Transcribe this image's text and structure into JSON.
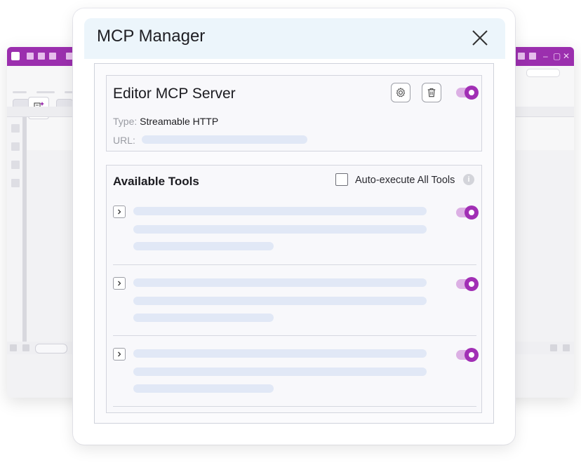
{
  "dialog": {
    "title": "MCP Manager",
    "close_icon": "close-icon"
  },
  "server": {
    "name": "Editor MCP Server",
    "type_label": "Type:",
    "type_value": "Streamable HTTP",
    "url_label": "URL:",
    "enabled": true,
    "settings_icon": "gear-icon",
    "delete_icon": "trash-icon"
  },
  "tools": {
    "title": "Available Tools",
    "auto_execute_label": "Auto-execute All Tools",
    "auto_execute_checked": false,
    "info_icon": "info-icon",
    "items": [
      {
        "enabled": true,
        "expand_icon": "chevron-right-icon"
      },
      {
        "enabled": true,
        "expand_icon": "chevron-right-icon"
      },
      {
        "enabled": true,
        "expand_icon": "chevron-right-icon"
      }
    ]
  },
  "colors": {
    "accent": "#a12fb5",
    "accent_light": "#dcb0e4",
    "titlebar": "#9b2fae",
    "header_bg": "#ecf5fb",
    "skeleton": "#e1e8f6"
  }
}
